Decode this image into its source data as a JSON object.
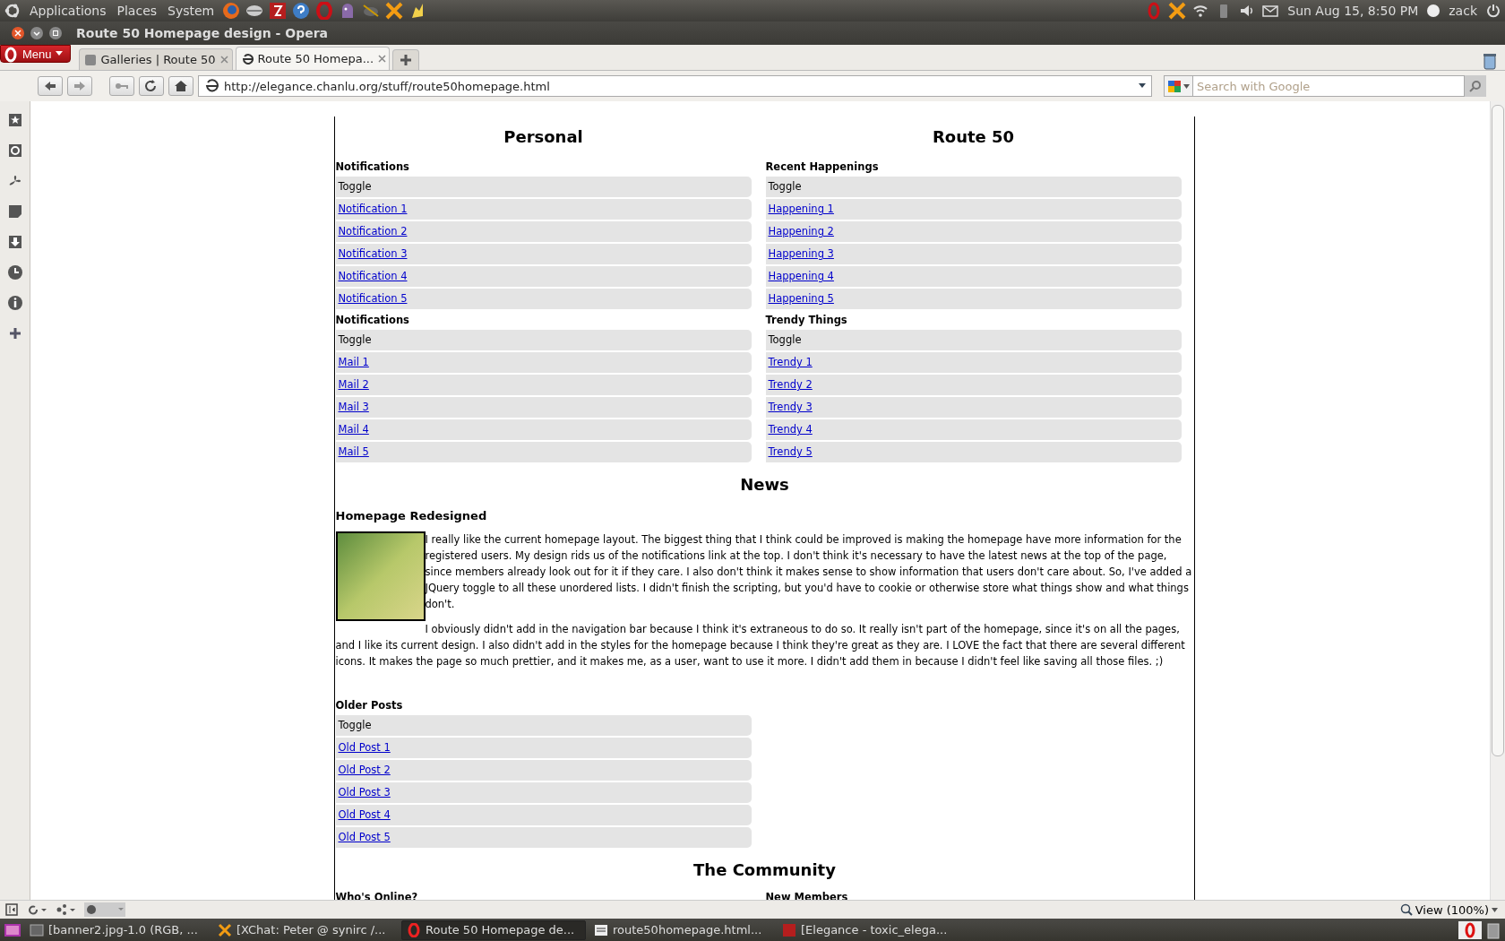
{
  "top_panel": {
    "menus": [
      "Applications",
      "Places",
      "System"
    ],
    "clock": "Sun Aug 15,  8:50 PM",
    "user": "zack"
  },
  "window": {
    "title": "Route 50 Homepage design - Opera"
  },
  "menu_button": "Menu",
  "tabs": [
    {
      "label": "Galleries | Route 50",
      "selected": false
    },
    {
      "label": "Route 50 Homepa...",
      "selected": true
    }
  ],
  "address": {
    "value": "http://elegance.chanlu.org/stuff/route50homepage.html"
  },
  "search": {
    "placeholder": "Search with Google"
  },
  "columns": [
    {
      "title": "Personal",
      "groups": [
        {
          "heading": "Notifications",
          "toggle": "Toggle",
          "links": [
            "Notification 1",
            "Notification 2",
            "Notification 3",
            "Notification 4",
            "Notification 5"
          ]
        },
        {
          "heading": "Notifications",
          "toggle": "Toggle",
          "links": [
            "Mail 1",
            "Mail 2",
            "Mail 3",
            "Mail 4",
            "Mail 5"
          ]
        }
      ]
    },
    {
      "title": "Route 50",
      "groups": [
        {
          "heading": "Recent Happenings",
          "toggle": "Toggle",
          "links": [
            "Happening 1",
            "Happening 2",
            "Happening 3",
            "Happening 4",
            "Happening 5"
          ]
        },
        {
          "heading": "Trendy Things",
          "toggle": "Toggle",
          "links": [
            "Trendy 1",
            "Trendy 2",
            "Trendy 3",
            "Trendy 4",
            "Trendy 5"
          ]
        }
      ]
    }
  ],
  "news": {
    "title": "News",
    "headline": "Homepage Redesigned",
    "paragraphs": [
      "I really like the current homepage layout. The biggest thing that I think could be improved is making the homepage have more information for the registered users. My design rids us of the notifications link at the top. I don't think it's necessary to have the latest news at the top of the page, since members already look out for it if they care. I also don't think it makes sense to show information that users don't care about. So, I've added a JQuery toggle to all these unordered lists. I didn't finish the scripting, but you'd have to cookie or otherwise store what things show and what things don't.",
      "I obviously didn't add in the navigation bar because I think it's extraneous to do so. It really isn't part of the homepage, since it's on all the pages, and I like its current design. I also didn't add in the styles for the homepage because I think they're great as they are. I LOVE the fact that there are several different icons. It makes the page so much prettier, and it makes me, as a user, want to use it more. I didn't add them in because I didn't feel like saving all those files. ;)"
    ]
  },
  "older_posts": {
    "heading": "Older Posts",
    "toggle": "Toggle",
    "links": [
      "Old Post 1",
      "Old Post 2",
      "Old Post 3",
      "Old Post 4",
      "Old Post 5"
    ]
  },
  "community": {
    "title": "The Community",
    "headings": [
      "Who's Online?",
      "New Members"
    ]
  },
  "status_bar": {
    "zoom": "View (100%)"
  },
  "taskbar": [
    {
      "label": "[banner2.jpg-1.0 (RGB, ...",
      "selected": false
    },
    {
      "label": "[XChat: Peter @ synirc /...",
      "selected": false
    },
    {
      "label": "Route 50 Homepage de...",
      "selected": true
    },
    {
      "label": "route50homepage.html...",
      "selected": false
    },
    {
      "label": "[Elegance - toxic_elega...",
      "selected": false
    }
  ]
}
